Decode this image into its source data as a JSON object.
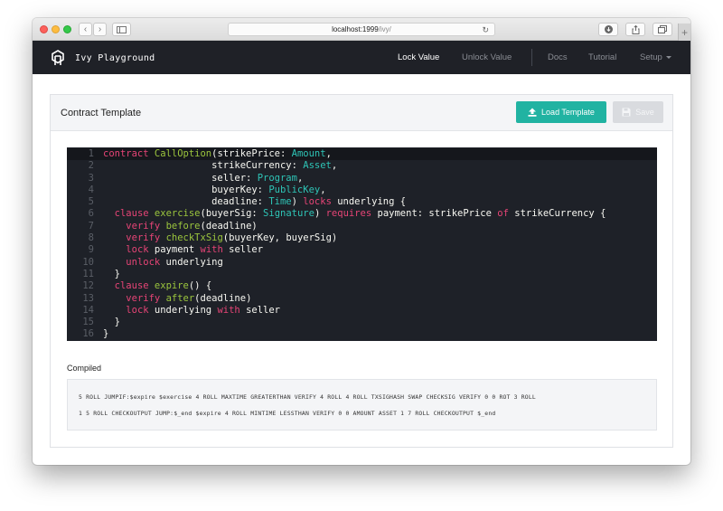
{
  "browser": {
    "url_host": "localhost:1999",
    "url_path": "/ivy/",
    "back_icon": "‹",
    "forward_icon": "›",
    "reload_icon": "↻",
    "new_tab_icon": "+"
  },
  "navbar": {
    "brand": "Ivy Playground",
    "links": [
      {
        "label": "Lock Value",
        "active": true
      },
      {
        "label": "Unlock Value",
        "active": false
      },
      {
        "label": "Docs",
        "active": false
      },
      {
        "label": "Tutorial",
        "active": false
      },
      {
        "label": "Setup",
        "active": false
      }
    ]
  },
  "panel": {
    "title": "Contract Template",
    "load_button": "Load Template",
    "save_button": "Save"
  },
  "editor": {
    "current_line": 1,
    "lines": [
      [
        [
          "kw",
          "contract "
        ],
        [
          "fn",
          "CallOption"
        ],
        [
          "pl",
          "(strikePrice: "
        ],
        [
          "ty",
          "Amount"
        ],
        [
          "pl",
          ","
        ]
      ],
      [
        [
          "pl",
          "                   strikeCurrency: "
        ],
        [
          "ty",
          "Asset"
        ],
        [
          "pl",
          ","
        ]
      ],
      [
        [
          "pl",
          "                   seller: "
        ],
        [
          "ty",
          "Program"
        ],
        [
          "pl",
          ","
        ]
      ],
      [
        [
          "pl",
          "                   buyerKey: "
        ],
        [
          "ty",
          "PublicKey"
        ],
        [
          "pl",
          ","
        ]
      ],
      [
        [
          "pl",
          "                   deadline: "
        ],
        [
          "ty",
          "Time"
        ],
        [
          "pl",
          ") "
        ],
        [
          "kw",
          "locks"
        ],
        [
          "pl",
          " underlying {"
        ]
      ],
      [
        [
          "pl",
          "  "
        ],
        [
          "kw",
          "clause "
        ],
        [
          "fn",
          "exercise"
        ],
        [
          "pl",
          "(buyerSig: "
        ],
        [
          "ty",
          "Signature"
        ],
        [
          "pl",
          ") "
        ],
        [
          "kw",
          "requires"
        ],
        [
          "pl",
          " payment: strikePrice "
        ],
        [
          "kw",
          "of"
        ],
        [
          "pl",
          " strikeCurrency {"
        ]
      ],
      [
        [
          "pl",
          "    "
        ],
        [
          "kw",
          "verify "
        ],
        [
          "fn",
          "before"
        ],
        [
          "pl",
          "(deadline)"
        ]
      ],
      [
        [
          "pl",
          "    "
        ],
        [
          "kw",
          "verify "
        ],
        [
          "fn",
          "checkTxSig"
        ],
        [
          "pl",
          "(buyerKey, buyerSig)"
        ]
      ],
      [
        [
          "pl",
          "    "
        ],
        [
          "kw",
          "lock"
        ],
        [
          "pl",
          " payment "
        ],
        [
          "kw",
          "with"
        ],
        [
          "pl",
          " seller"
        ]
      ],
      [
        [
          "pl",
          "    "
        ],
        [
          "kw",
          "unlock"
        ],
        [
          "pl",
          " underlying"
        ]
      ],
      [
        [
          "pl",
          "  }"
        ]
      ],
      [
        [
          "pl",
          "  "
        ],
        [
          "kw",
          "clause "
        ],
        [
          "fn",
          "expire"
        ],
        [
          "pl",
          "() {"
        ]
      ],
      [
        [
          "pl",
          "    "
        ],
        [
          "kw",
          "verify "
        ],
        [
          "fn",
          "after"
        ],
        [
          "pl",
          "(deadline)"
        ]
      ],
      [
        [
          "pl",
          "    "
        ],
        [
          "kw",
          "lock"
        ],
        [
          "pl",
          " underlying "
        ],
        [
          "kw",
          "with"
        ],
        [
          "pl",
          " seller"
        ]
      ],
      [
        [
          "pl",
          "  }"
        ]
      ],
      [
        [
          "pl",
          "}"
        ]
      ]
    ]
  },
  "compiled": {
    "label": "Compiled",
    "lines": [
      "5 ROLL JUMPIF:$expire $exercise 4 ROLL MAXTIME GREATERTHAN VERIFY 4 ROLL 4 ROLL TXSIGHASH SWAP CHECKSIG VERIFY 0 0 ROT 3 ROLL",
      "1 5 ROLL CHECKOUTPUT JUMP:$_end $expire 4 ROLL MINTIME LESSTHAN VERIFY 0 0 AMOUNT ASSET 1 7 ROLL CHECKOUTPUT $_end"
    ]
  },
  "colors": {
    "accent": "#21b3a2",
    "navbar_bg": "#1f2127",
    "editor_bg": "#1e2128",
    "keyword": "#e64476",
    "function": "#9bc53d",
    "type": "#2ec4b6"
  }
}
